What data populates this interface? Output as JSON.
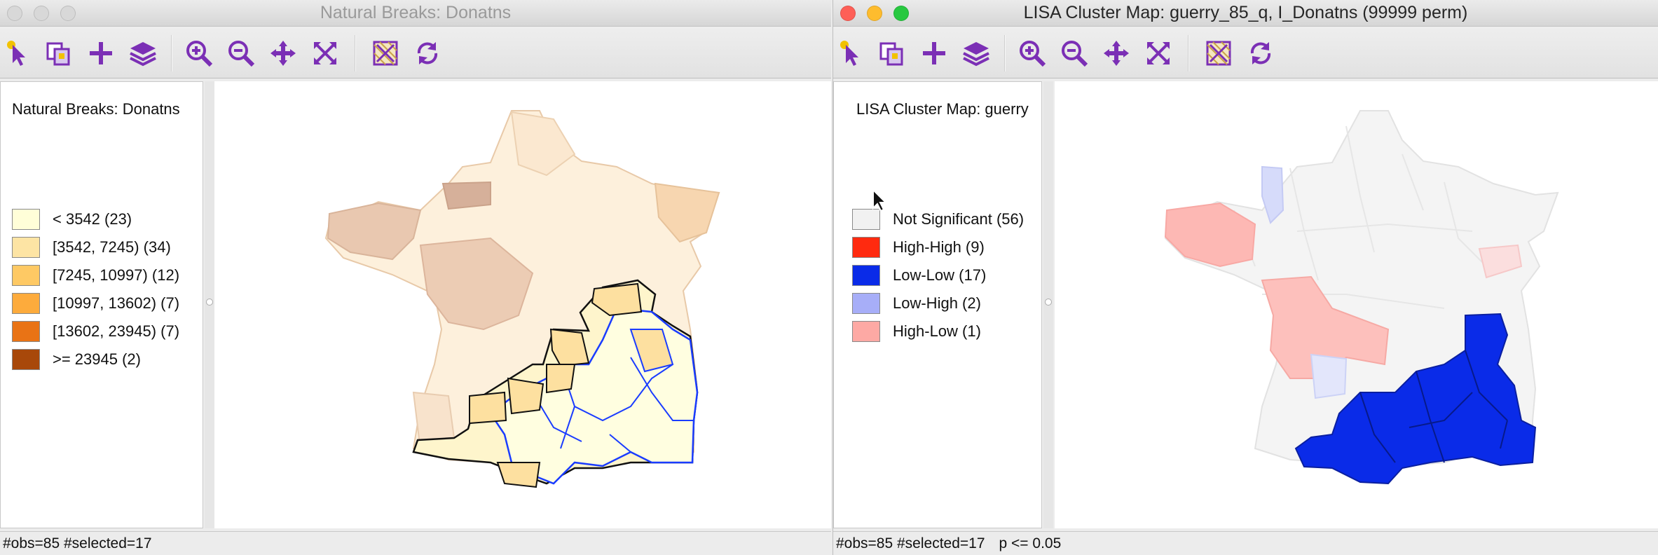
{
  "left_window": {
    "title": "Natural Breaks: Donatns",
    "legend_title": "Natural Breaks: Donatns",
    "legend": [
      {
        "label": "< 3542 (23)",
        "color": "#fffed8"
      },
      {
        "label": "[3542, 7245) (34)",
        "color": "#fde4a4"
      },
      {
        "label": "[7245, 10997) (12)",
        "color": "#fec964"
      },
      {
        "label": "[10997, 13602) (7)",
        "color": "#fdab3c"
      },
      {
        "label": "[13602, 23945) (7)",
        "color": "#e97315"
      },
      {
        "label": ">= 23945 (2)",
        "color": "#a8480a"
      }
    ],
    "status": "#obs=85 #selected=17"
  },
  "right_window": {
    "title": "LISA Cluster Map: guerry_85_q, I_Donatns (99999 perm)",
    "legend_title": "LISA Cluster Map: guerry",
    "legend": [
      {
        "label": "Not Significant (56)",
        "color": "#f1f1f1"
      },
      {
        "label": "High-High (9)",
        "color": "#ff2a0f"
      },
      {
        "label": "Low-Low (17)",
        "color": "#0a2be8"
      },
      {
        "label": "Low-High (2)",
        "color": "#a7aef8"
      },
      {
        "label": "High-Low (1)",
        "color": "#fda9a4"
      }
    ],
    "status": "#obs=85 #selected=17",
    "status_extra": "p <= 0.05"
  },
  "toolbar_icons": [
    "select-arrow-icon",
    "selection-copy-icon",
    "add-icon",
    "layers-icon",
    "zoom-in-icon",
    "zoom-out-icon",
    "pan-icon",
    "fit-extent-icon",
    "basemap-icon",
    "refresh-icon"
  ],
  "theme": {
    "icon_purple": "#7b2fb5",
    "selection_blue": "#1a3cff"
  }
}
